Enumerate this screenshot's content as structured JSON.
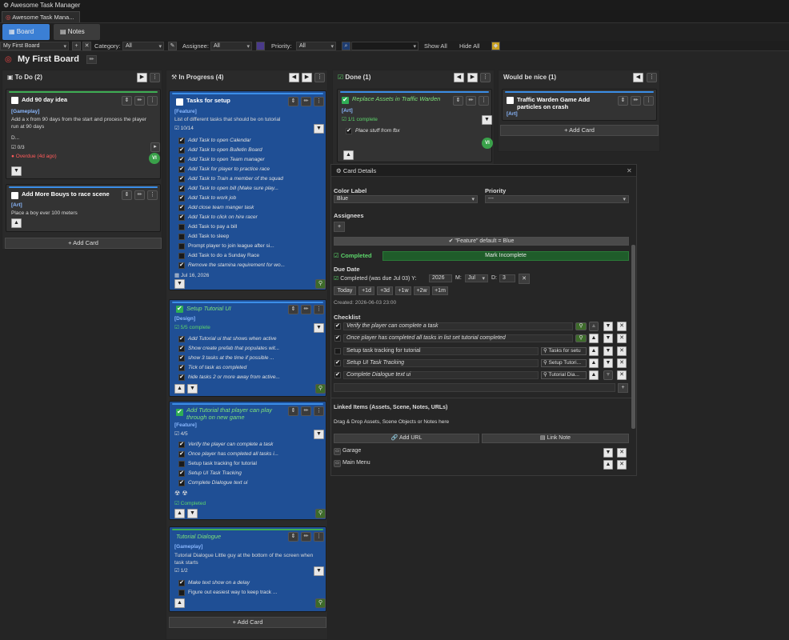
{
  "app": {
    "title": "Awesome Task Manager",
    "tab": "Awesome Task Mana..."
  },
  "modes": {
    "board": "Board",
    "notes": "Notes"
  },
  "filters": {
    "board": "My First Board",
    "category_label": "Category:",
    "category": "All",
    "assignee_label": "Assignee:",
    "assignee": "All",
    "priority_label": "Priority:",
    "priority": "All",
    "search_placeholder": "",
    "show_all": "Show All",
    "hide_all": "Hide All"
  },
  "board": {
    "title": "My First Board"
  },
  "columns": {
    "todo": {
      "title": "To Do",
      "count": "(2)",
      "add_card": "+ Add Card"
    },
    "progress": {
      "title": "In Progress",
      "count": "(4)",
      "add_card": "+ Add Card"
    },
    "done": {
      "title": "Done",
      "count": "(1)"
    },
    "nice": {
      "title": "Would be nice",
      "count": "(1)",
      "add_card": "+ Add Card"
    }
  },
  "todo_cards": [
    {
      "title": "Add 90 day idea",
      "tag": "[Gameplay]",
      "desc": "Add a x from 90 days from the start and process the player run at 90 days",
      "more": "D...",
      "count": "☑ 0/3",
      "overdue": "Overdue (4d ago)",
      "avatar": "VI"
    },
    {
      "title": "Add More Bouys to race scene",
      "tag": "[Art]",
      "desc": "Place a boy ever 100 meters"
    }
  ],
  "progress_cards": [
    {
      "title": "Tasks for setup",
      "tag": "[Feature]",
      "desc": "List of different tasks that should be on tutorial",
      "count": "☑ 10/14",
      "items": [
        {
          "t": "Add Task to open Calendar",
          "d": true
        },
        {
          "t": "Add Task to open Bulletin Board",
          "d": true
        },
        {
          "t": "Add Task to open Team manager",
          "d": true
        },
        {
          "t": "Add Task for player to practice race",
          "d": true
        },
        {
          "t": "Add Task to Train a member of the squad",
          "d": true
        },
        {
          "t": "Add Task to open bill (Make sure play...",
          "d": true
        },
        {
          "t": "Add Task to work job",
          "d": true
        },
        {
          "t": "Add close team manger task",
          "d": true
        },
        {
          "t": "Add Task to click on hire racer",
          "d": true
        },
        {
          "t": "Add Task to pay a bill",
          "d": false
        },
        {
          "t": "Add Task to sleep",
          "d": false
        },
        {
          "t": "Prompt player to join league after si...",
          "d": false
        },
        {
          "t": "Add Task to do a Sunday Race",
          "d": false
        },
        {
          "t": "Remove the stamina requirement for wo...",
          "d": true
        }
      ],
      "date": "Jul 16, 2026"
    },
    {
      "title": "Setup Tutorial UI",
      "tag": "[Design]",
      "complete": "5/5 complete",
      "items": [
        {
          "t": "Add Tutorial ui that shows when active",
          "d": true
        },
        {
          "t": "Show create prefab that populates wit...",
          "d": true
        },
        {
          "t": "show 3 tasks at the time if possible ...",
          "d": true
        },
        {
          "t": "Tick of task as completed",
          "d": true
        },
        {
          "t": "hide tasks 2 or more away from active...",
          "d": true
        }
      ]
    },
    {
      "title": "Add Tutorial that player can play through on new game",
      "tag": "[Feature]",
      "count": "☑ 4/5",
      "items": [
        {
          "t": "Verify the player can complete a task",
          "d": true
        },
        {
          "t": "Once player has completed all tasks i...",
          "d": true
        },
        {
          "t": "Setup task tracking for tutorial",
          "d": false
        },
        {
          "t": "Setup UI Task Tracking",
          "d": true
        },
        {
          "t": "Complete Dialogue text ui",
          "d": true
        }
      ],
      "completed": "Completed"
    },
    {
      "title": "Tutorial Dialogue",
      "tag": "[Gameplay]",
      "desc": "Tutorial Dialogue Little guy at the bottom of the screen when task starts",
      "count": "☑ 1/2",
      "items": [
        {
          "t": "Make text show on a delay",
          "d": true
        },
        {
          "t": "Figure out easiest way to keep track ...",
          "d": false
        }
      ]
    }
  ],
  "done_card": {
    "title": "Replace Assets in Traffic Warden",
    "tag": "[Art]",
    "complete": "1/1 complete",
    "item": "Place stuff from fbx",
    "avatar": "VI"
  },
  "nice_card": {
    "title": "Traffic Warden Game Add particles on crash",
    "tag": "[Art]"
  },
  "details": {
    "title": "Card Details",
    "color_label": "Color Label",
    "color": "Blue",
    "priority_label": "Priority",
    "priority": "---",
    "assignees_label": "Assignees",
    "feature_default": "✔ \"Feature\" default = Blue",
    "completed": "Completed",
    "mark_incomplete": "Mark Incomplete",
    "due_label": "Due Date",
    "due_text": "Completed (was due Jul 03) Y:",
    "year": "2026",
    "m_label": "M:",
    "month": "Jul",
    "d_label": "D:",
    "day": "3",
    "quick": [
      "Today",
      "+1d",
      "+3d",
      "+1w",
      "+2w",
      "+1m"
    ],
    "created": "Created: 2026-06-03 23:00",
    "checklist_label": "Checklist",
    "checklist": [
      {
        "t": "Verify the player can complete a task",
        "link": "",
        "d": true
      },
      {
        "t": "Once player has completed all tasks in list set tutorial completed",
        "link": "",
        "d": true
      },
      {
        "t": "Setup task tracking for tutorial",
        "link": "Tasks for setu",
        "d": false
      },
      {
        "t": "Setup UI Task Tracking",
        "link": "Setup Tutori...",
        "d": true
      },
      {
        "t": "Complete Dialogue text ui",
        "link": "Tutorial Dia...",
        "d": true
      }
    ],
    "linked_label": "Linked Items (Assets, Scene, Notes, URLs)",
    "drop_hint": "Drag & Drop Assets, Scene Objects or Notes here",
    "add_url": "Add URL",
    "link_note": "Link Note",
    "linked": [
      "Garage",
      "Main Menu"
    ]
  }
}
